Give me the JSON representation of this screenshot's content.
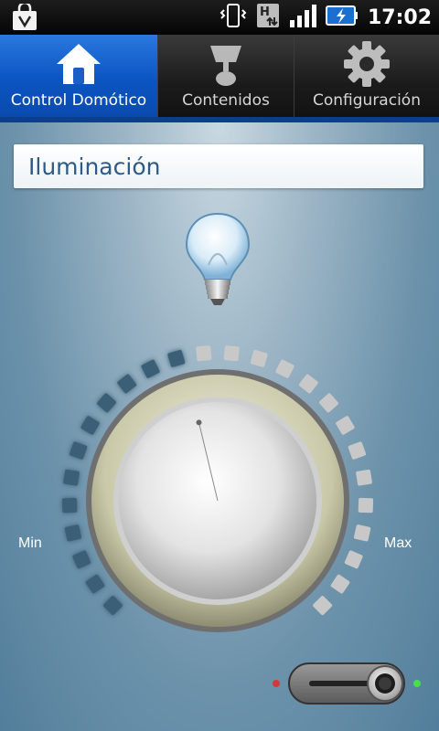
{
  "status_bar": {
    "time": "17:02",
    "icons": [
      "shopping-bag-icon",
      "vibrate-icon",
      "hspa-data-icon",
      "signal-icon",
      "battery-charging-icon"
    ]
  },
  "tabs": [
    {
      "label": "Control Domótico",
      "icon": "home-icon",
      "active": true
    },
    {
      "label": "Contenidos",
      "icon": "lamp-icon",
      "active": false
    },
    {
      "label": "Configuración",
      "icon": "gear-icon",
      "active": false
    }
  ],
  "main": {
    "section_title": "Iluminación",
    "dial": {
      "min_label": "Min",
      "max_label": "Max",
      "level_fraction": 0.45
    },
    "power_toggle": {
      "state": "on"
    }
  },
  "colors": {
    "active_tab": "#0b55c2",
    "title_text": "#2b5b87",
    "led_off": "#d23a3a",
    "led_on": "#45e04a"
  }
}
